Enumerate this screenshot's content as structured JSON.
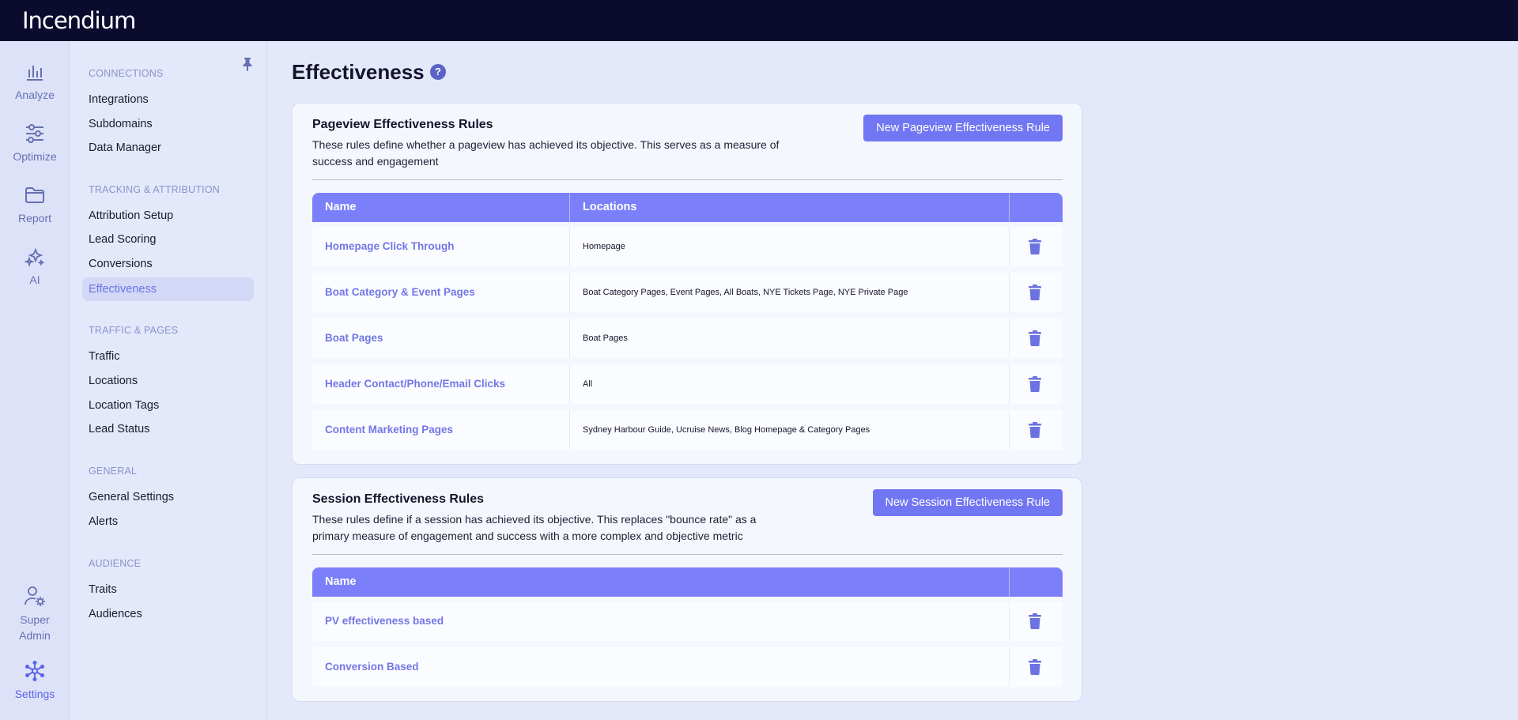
{
  "app": {
    "logo": "Incendium"
  },
  "rail": [
    {
      "label": "Analyze",
      "icon": "chart-icon"
    },
    {
      "label": "Optimize",
      "icon": "sliders-icon"
    },
    {
      "label": "Report",
      "icon": "folder-icon"
    },
    {
      "label": "AI",
      "icon": "sparkles-icon"
    },
    {
      "label_line1": "Super",
      "label_line2": "Admin",
      "icon": "user-gear-icon"
    },
    {
      "label": "Settings",
      "icon": "settings-network-icon"
    }
  ],
  "sidebar": {
    "sections": [
      {
        "title": "CONNECTIONS",
        "items": [
          "Integrations",
          "Subdomains",
          "Data Manager"
        ]
      },
      {
        "title": "TRACKING & ATTRIBUTION",
        "items": [
          "Attribution Setup",
          "Lead Scoring",
          "Conversions",
          "Effectiveness"
        ]
      },
      {
        "title": "TRAFFIC & PAGES",
        "items": [
          "Traffic",
          "Locations",
          "Location Tags",
          "Lead Status"
        ]
      },
      {
        "title": "GENERAL",
        "items": [
          "General Settings",
          "Alerts"
        ]
      },
      {
        "title": "AUDIENCE",
        "items": [
          "Traits",
          "Audiences"
        ]
      }
    ],
    "active_item": "Effectiveness"
  },
  "page": {
    "title": "Effectiveness",
    "help": "?"
  },
  "pageview": {
    "title": "Pageview Effectiveness Rules",
    "description": "These rules define whether a pageview has achieved its objective. This serves as a measure of success and engagement",
    "button": "New Pageview Effectiveness Rule",
    "columns": [
      "Name",
      "Locations"
    ],
    "rows": [
      {
        "name": "Homepage Click Through",
        "locations": "Homepage"
      },
      {
        "name": "Boat Category & Event Pages",
        "locations": "Boat Category Pages, Event Pages, All Boats, NYE Tickets Page, NYE Private Page"
      },
      {
        "name": "Boat Pages",
        "locations": "Boat Pages"
      },
      {
        "name": "Header Contact/Phone/Email Clicks",
        "locations": "All"
      },
      {
        "name": "Content Marketing Pages",
        "locations": "Sydney Harbour Guide, Ucruise News, Blog Homepage & Category Pages"
      }
    ]
  },
  "session": {
    "title": "Session Effectiveness Rules",
    "description": "These rules define if a session has achieved its objective. This replaces \"bounce rate\" as a primary measure of engagement and success with a more complex and objective metric",
    "button": "New Session Effectiveness Rule",
    "columns": [
      "Name"
    ],
    "rows": [
      {
        "name": "PV effectiveness based"
      },
      {
        "name": "Conversion Based"
      }
    ]
  },
  "colors": {
    "accent": "#7176f2",
    "topbar": "#0b0b2e",
    "link": "#7277e6"
  }
}
